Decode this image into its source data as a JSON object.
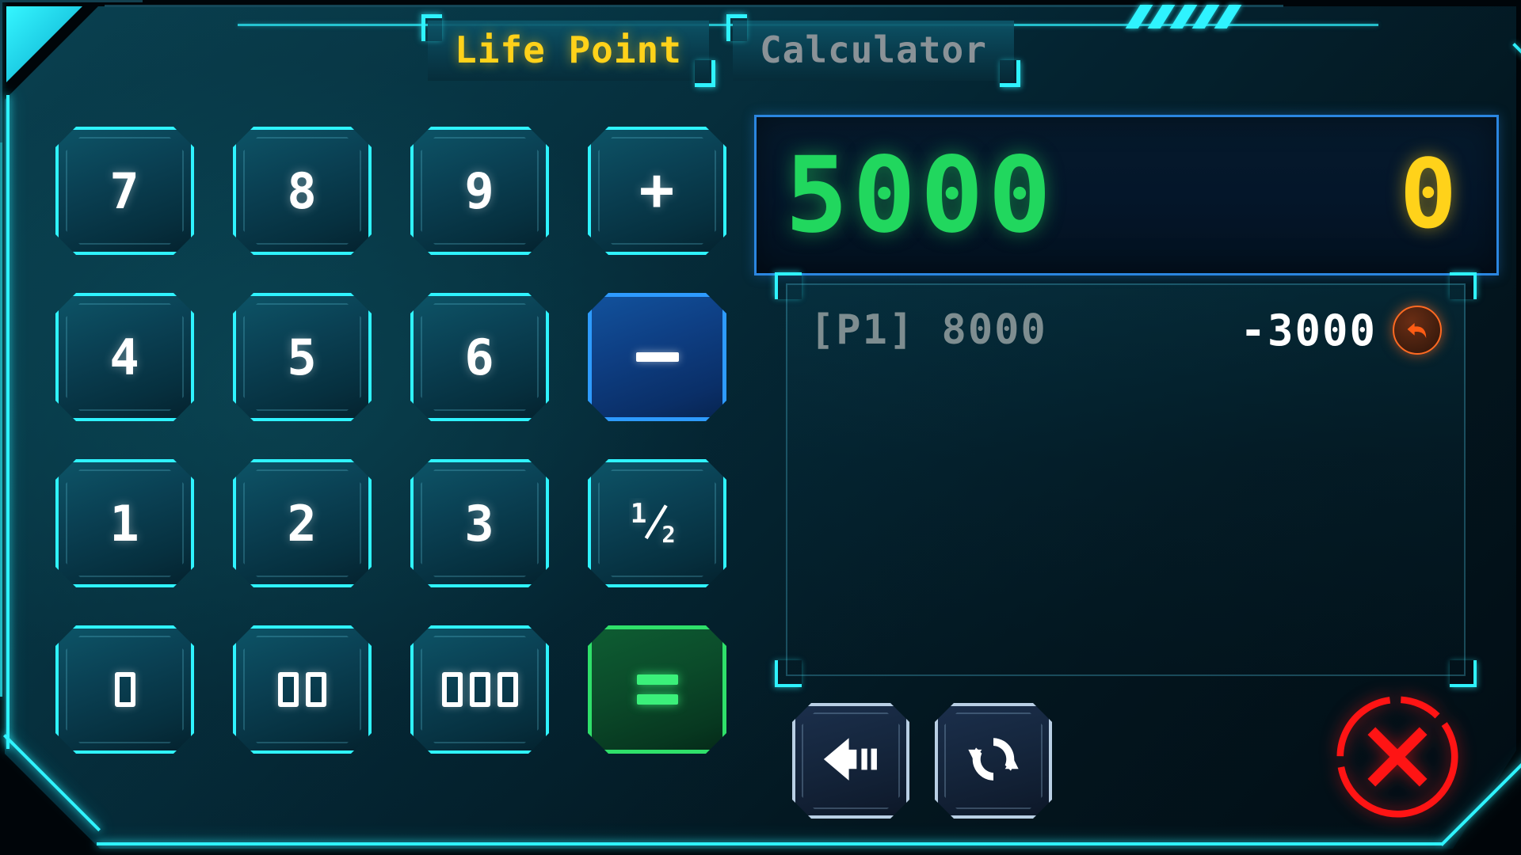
{
  "app": {
    "title": "Life Point Calculator"
  },
  "tabs": [
    {
      "id": "life-point",
      "label": "Life Point",
      "active": true,
      "color": "#ffd21a"
    },
    {
      "id": "calculator",
      "label": "Calculator",
      "active": false,
      "color": "#8a9297"
    }
  ],
  "display": {
    "total": "5000",
    "entry": "0",
    "total_color": "#21d75e",
    "entry_color": "#ffd21a",
    "border_color": "#2b86e0"
  },
  "keypad": {
    "keys": [
      {
        "id": "7",
        "label": "7",
        "type": "digit"
      },
      {
        "id": "8",
        "label": "8",
        "type": "digit"
      },
      {
        "id": "9",
        "label": "9",
        "type": "digit"
      },
      {
        "id": "plus",
        "label": "+",
        "type": "operator"
      },
      {
        "id": "4",
        "label": "4",
        "type": "digit"
      },
      {
        "id": "5",
        "label": "5",
        "type": "digit"
      },
      {
        "id": "6",
        "label": "6",
        "type": "digit"
      },
      {
        "id": "minus",
        "label": "-",
        "type": "operator",
        "state": "selected"
      },
      {
        "id": "1",
        "label": "1",
        "type": "digit"
      },
      {
        "id": "2",
        "label": "2",
        "type": "digit"
      },
      {
        "id": "3",
        "label": "3",
        "type": "digit"
      },
      {
        "id": "half",
        "label": "1/2",
        "type": "operator"
      },
      {
        "id": "0",
        "label": "0",
        "type": "digit"
      },
      {
        "id": "00",
        "label": "00",
        "type": "digit"
      },
      {
        "id": "000",
        "label": "000",
        "type": "digit"
      },
      {
        "id": "equals",
        "label": "=",
        "type": "operator",
        "state": "confirm"
      }
    ],
    "selected_color": "#2e9bff",
    "confirm_color": "#3bf07a",
    "border_color": "#2ff3ff"
  },
  "log": {
    "entries": [
      {
        "player": "[P1]",
        "life": "8000",
        "label": "[P1] 8000",
        "delta": "-3000",
        "undo_icon": "undo-arrow-icon",
        "undo_color": "#ff6a22"
      }
    ]
  },
  "actions": [
    {
      "id": "backspace",
      "icon": "backspace-arrow-icon",
      "label": "Backspace"
    },
    {
      "id": "reset",
      "icon": "refresh-cycle-icon",
      "label": "Reset"
    }
  ],
  "close_button": {
    "icon": "close-x-circle-icon",
    "label": "Close",
    "color": "#ff1414"
  },
  "decor": {
    "hash_count": 5,
    "accent_color": "#2ff3ff"
  }
}
